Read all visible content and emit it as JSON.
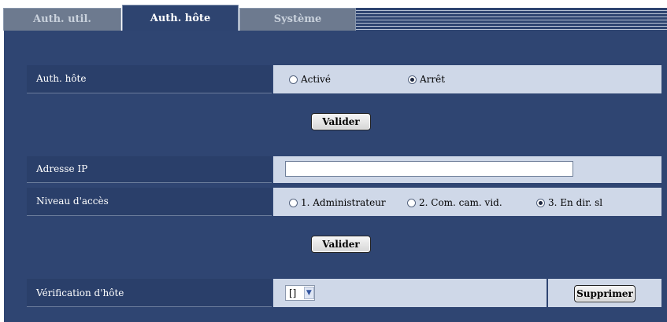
{
  "tabs": [
    {
      "label": "Auth. util.",
      "active": false
    },
    {
      "label": "Auth. hôte",
      "active": true
    },
    {
      "label": "Système",
      "active": false
    }
  ],
  "host_auth": {
    "label": "Auth. hôte",
    "options": [
      "Activé",
      "Arrêt"
    ],
    "selected": "Arrêt",
    "submit": "Valider"
  },
  "ip_address": {
    "label": "Adresse IP",
    "value": ""
  },
  "access_level": {
    "label": "Niveau d'accès",
    "options": [
      "1. Administrateur",
      "2. Com. cam. vid.",
      "3. En dir. sl"
    ],
    "selected": "3. En dir. sl",
    "submit": "Valider"
  },
  "host_check": {
    "label": "Vérification d'hôte",
    "selected": "[]",
    "delete": "Supprimer"
  },
  "colors": {
    "panel": "#2f4572",
    "label_bg": "#2a3f6a",
    "value_bg": "#cfd8e8",
    "tab_active": "#2e4470",
    "tab_inactive": "#6d7a8f"
  },
  "icons": {
    "select_arrow": "chevron-down-icon"
  }
}
